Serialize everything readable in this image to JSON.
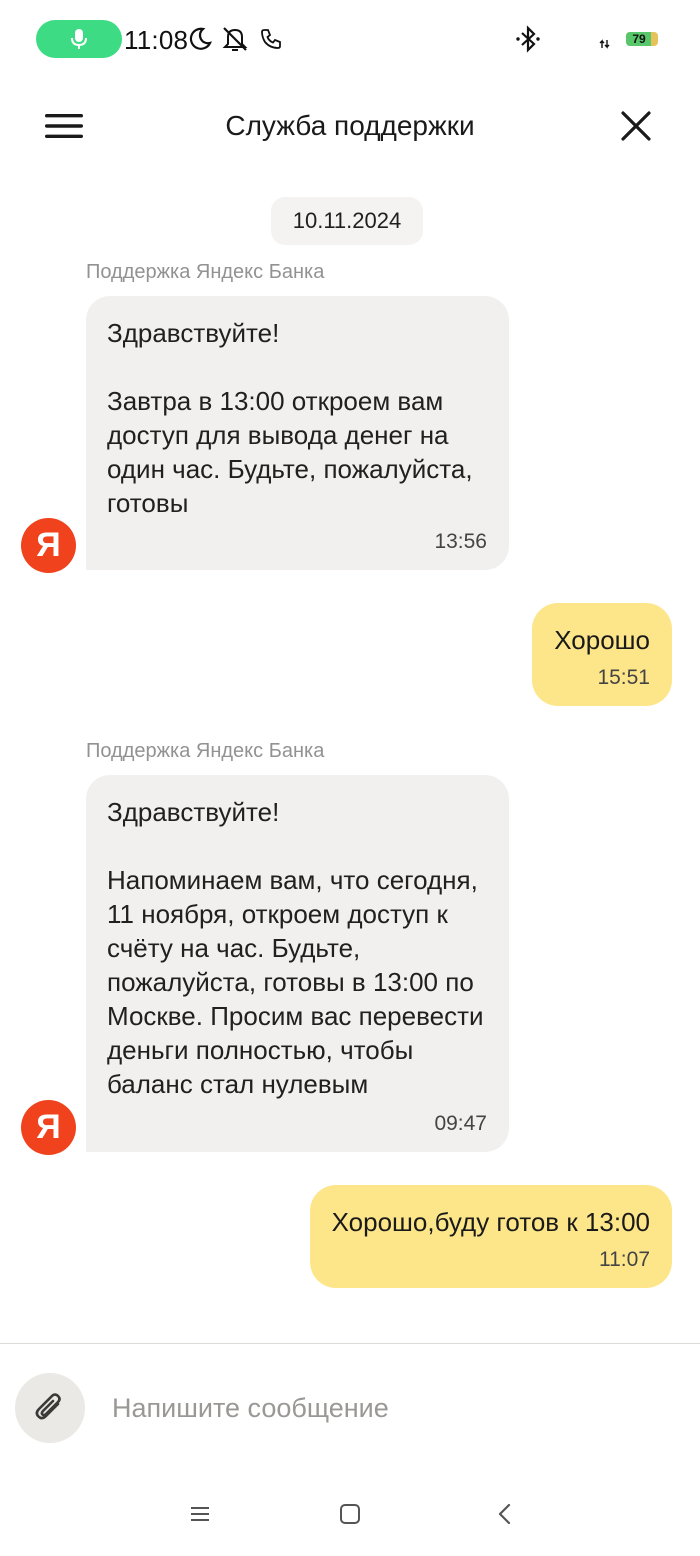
{
  "status_bar": {
    "time": "11:08",
    "battery_level": "79",
    "battery_fraction": 0.79,
    "icons": [
      "mic-icon",
      "moon-icon",
      "bell-off-icon",
      "phone-icon",
      "bluetooth-icon",
      "signal-icon",
      "battery-icon"
    ]
  },
  "header": {
    "title": "Служба поддержки",
    "menu_icon": "hamburger-menu-icon",
    "close_icon": "close-icon"
  },
  "chat": {
    "date": "10.11.2024",
    "messages": [
      {
        "direction": "incoming",
        "sender": "Поддержка Яндекс Банка",
        "avatar": "Я",
        "text": "Здравствуйте!\n\nЗавтра в 13:00 откроем вам доступ для вывода денег на один час. Будьте, пожалуйста, готовы",
        "time": "13:56"
      },
      {
        "direction": "outgoing",
        "text": "Хорошо",
        "time": "15:51"
      },
      {
        "direction": "incoming",
        "sender": "Поддержка Яндекс Банка",
        "avatar": "Я",
        "text": "Здравствуйте!\n\nНапоминаем вам, что сегодня, 11 ноября, откроем доступ к счёту на час. Будьте, пожалуйста, готовы в 13:00 по Москве. Просим вас перевести деньги полностью, чтобы баланс стал нулевым",
        "time": "09:47"
      },
      {
        "direction": "outgoing",
        "text": "Хорошо,буду готов к 13:00",
        "time": "11:07"
      }
    ]
  },
  "composer": {
    "attach_icon": "paperclip-icon",
    "value": "",
    "placeholder": "Напишите сообщение"
  },
  "nav_bar": {
    "icons": [
      "recent-apps-icon",
      "home-icon",
      "back-icon"
    ]
  },
  "colors": {
    "incoming_bubble": "#f1f0ee",
    "outgoing_bubble": "#fde68a",
    "avatar": "#f0421c",
    "mic_pill": "#3ddc84"
  }
}
